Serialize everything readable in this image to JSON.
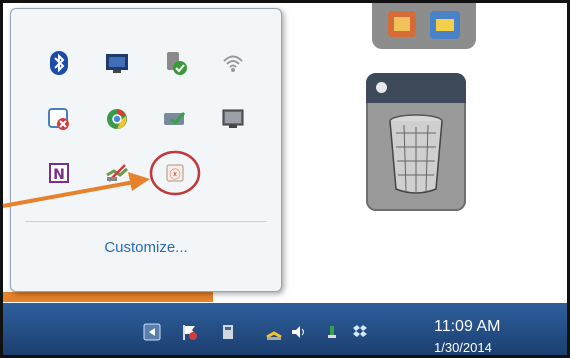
{
  "tray_overflow": {
    "customize_label": "Customize...",
    "icons": [
      "bluetooth-icon",
      "monitor-app-icon",
      "usb-safely-remove-icon",
      "wireless-network-icon",
      "action-center-icon",
      "chrome-icon",
      "sync-check-icon",
      "display-icon",
      "onenote-icon",
      "network-disabled-icon",
      "highlighted-app-icon"
    ],
    "highlight_color": "#c0393b"
  },
  "taskbar": {
    "clock_time": "11:09 AM",
    "clock_date": "1/30/2014",
    "icons": [
      "show-hidden-icons-button",
      "action-center-flag-icon",
      "power-icon",
      "network-icon",
      "volume-icon",
      "update-icon",
      "dropbox-icon"
    ]
  },
  "colors": {
    "annotation_arrow": "#e6822b",
    "taskbar": "#2e5f9c",
    "link": "#2a6cb5"
  }
}
